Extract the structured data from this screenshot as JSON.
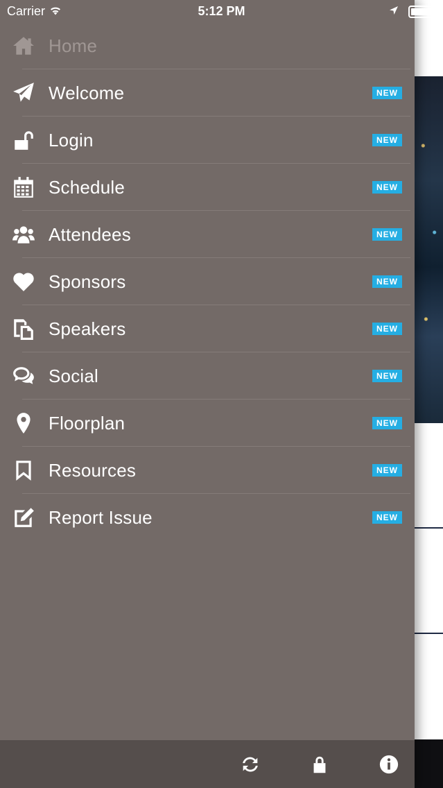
{
  "status_bar": {
    "carrier": "Carrier",
    "time": "5:12 PM"
  },
  "menu": {
    "items": [
      {
        "label": "Home",
        "icon": "home-icon"
      },
      {
        "label": "Welcome",
        "icon": "paper-plane-icon",
        "badge": "NEW"
      },
      {
        "label": "Login",
        "icon": "unlock-icon",
        "badge": "NEW"
      },
      {
        "label": "Schedule",
        "icon": "calendar-icon",
        "badge": "NEW"
      },
      {
        "label": "Attendees",
        "icon": "users-icon",
        "badge": "NEW"
      },
      {
        "label": "Sponsors",
        "icon": "heart-icon",
        "badge": "NEW"
      },
      {
        "label": "Speakers",
        "icon": "documents-icon",
        "badge": "NEW"
      },
      {
        "label": "Social",
        "icon": "chat-bubbles-icon",
        "badge": "NEW"
      },
      {
        "label": "Floorplan",
        "icon": "map-marker-icon",
        "badge": "NEW"
      },
      {
        "label": "Resources",
        "icon": "bookmark-icon",
        "badge": "NEW"
      },
      {
        "label": "Report Issue",
        "icon": "edit-icon",
        "badge": "NEW"
      }
    ]
  },
  "toolbar": {
    "icons": [
      "refresh-icon",
      "lock-icon",
      "info-icon"
    ]
  },
  "colors": {
    "drawer_bg": "#736a67",
    "badge": "#25aee3",
    "toolbar_bg": "#554e4c"
  }
}
